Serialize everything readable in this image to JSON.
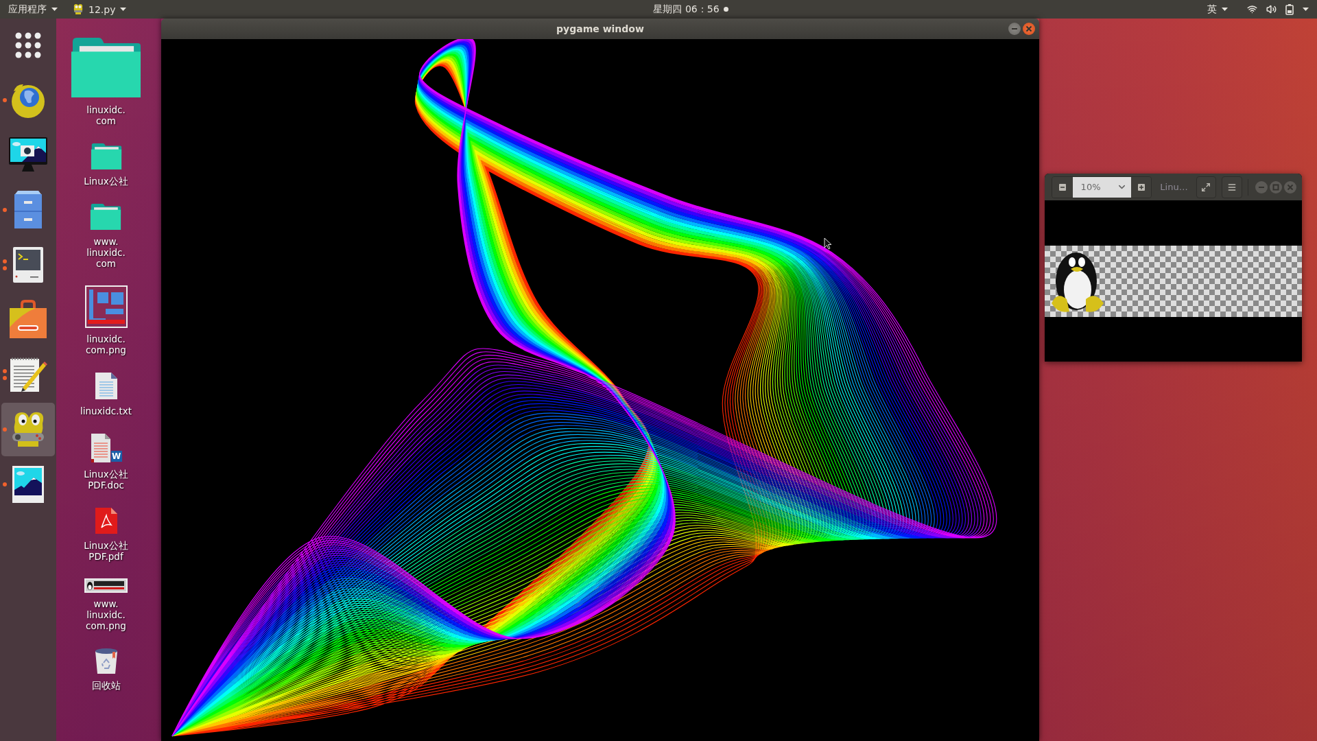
{
  "top_bar": {
    "applications_menu": "应用程序",
    "active_app": "12.py",
    "clock": "星期四 06：56",
    "notification": true,
    "input_method": "英"
  },
  "dock": {
    "items": [
      {
        "kind": "browser",
        "selected": false,
        "running": true,
        "multiple_windows": false
      },
      {
        "kind": "screenshot",
        "selected": false,
        "running": false,
        "multiple_windows": false
      },
      {
        "kind": "files",
        "selected": false,
        "running": true,
        "multiple_windows": false
      },
      {
        "kind": "terminal",
        "selected": false,
        "running": true,
        "multiple_windows": true
      },
      {
        "kind": "software",
        "selected": false,
        "running": false,
        "multiple_windows": false
      },
      {
        "kind": "editor",
        "selected": false,
        "running": true,
        "multiple_windows": true
      },
      {
        "kind": "game",
        "selected": true,
        "running": true,
        "multiple_windows": false
      },
      {
        "kind": "viewer",
        "selected": false,
        "running": true,
        "multiple_windows": false
      }
    ]
  },
  "desktop_icons": [
    {
      "kind": "folder",
      "large": true,
      "lines": [
        "linuxidc.",
        "com"
      ]
    },
    {
      "kind": "folder",
      "large": false,
      "lines": [
        "Linux公社"
      ]
    },
    {
      "kind": "folder",
      "large": false,
      "lines": [
        "www.",
        "linuxidc.",
        "com"
      ]
    },
    {
      "kind": "image",
      "large": false,
      "lines": [
        "linuxidc.",
        "com.png"
      ]
    },
    {
      "kind": "text",
      "large": false,
      "lines": [
        "linuxidc.txt"
      ]
    },
    {
      "kind": "document",
      "large": false,
      "badge": "W",
      "lines": [
        "Linux公社",
        "PDF.doc"
      ]
    },
    {
      "kind": "pdf",
      "large": false,
      "lines": [
        "Linux公社",
        "PDF.pdf"
      ]
    },
    {
      "kind": "banner",
      "large": false,
      "lines": [
        "www.",
        "linuxidc.",
        "com.png"
      ]
    },
    {
      "kind": "trash",
      "large": false,
      "lines": [
        "回收站"
      ]
    }
  ],
  "pygame_window": {
    "title": "pygame window"
  },
  "image_viewer": {
    "zoom": "10%",
    "title": "Linu…"
  }
}
